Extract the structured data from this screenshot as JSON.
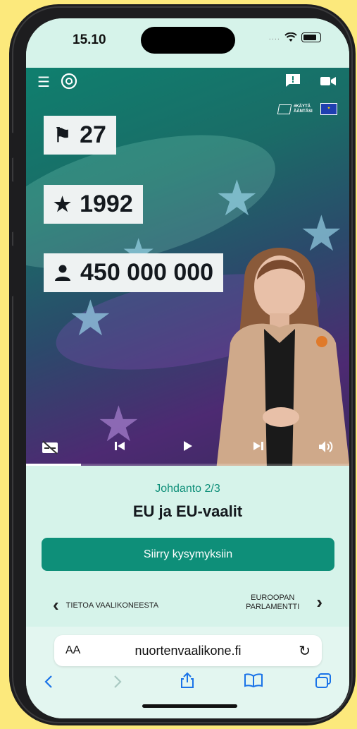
{
  "status": {
    "time": "15.10",
    "dots": "....",
    "wifi_icon": "wifi-icon",
    "battery_icon": "battery-icon"
  },
  "video": {
    "top_icons": [
      "menu-icon",
      "app-logo-icon",
      "feedback-icon",
      "camera-icon"
    ],
    "badge": {
      "text": "#KÄYTÄ ÄÄNTÄSI",
      "flag_icon": "eu-flag-icon"
    },
    "stats": [
      {
        "icon": "flag-icon",
        "symbol": "⚑",
        "value": "27"
      },
      {
        "icon": "star-icon",
        "symbol": "★",
        "value": "1992"
      },
      {
        "icon": "person-icon",
        "symbol": "👤",
        "value": "450 000 000"
      }
    ],
    "controls": [
      "subtitles-off-icon",
      "skip-previous-icon",
      "play-icon",
      "skip-next-icon",
      "volume-icon"
    ],
    "progress": 0.17,
    "colors": {
      "flag_teal": "#0f7f6e",
      "flag_purple": "#4d2a72"
    }
  },
  "content": {
    "chapter": "Johdanto 2/3",
    "title": "EU ja EU-vaalit",
    "cta_label": "Siirry kysymyksiin",
    "prev_label": "TIETOA VAALIKONEESTA",
    "next_label_line1": "EUROOPAN",
    "next_label_line2": "PARLAMENTTI",
    "accent": "#0e8f79"
  },
  "browser": {
    "aa": "AA",
    "url": "nuortenvaalikone.fi",
    "toolbar": [
      "back-icon",
      "forward-icon",
      "share-icon",
      "bookmarks-icon",
      "tabs-icon"
    ],
    "accent": "#1a73e8"
  }
}
